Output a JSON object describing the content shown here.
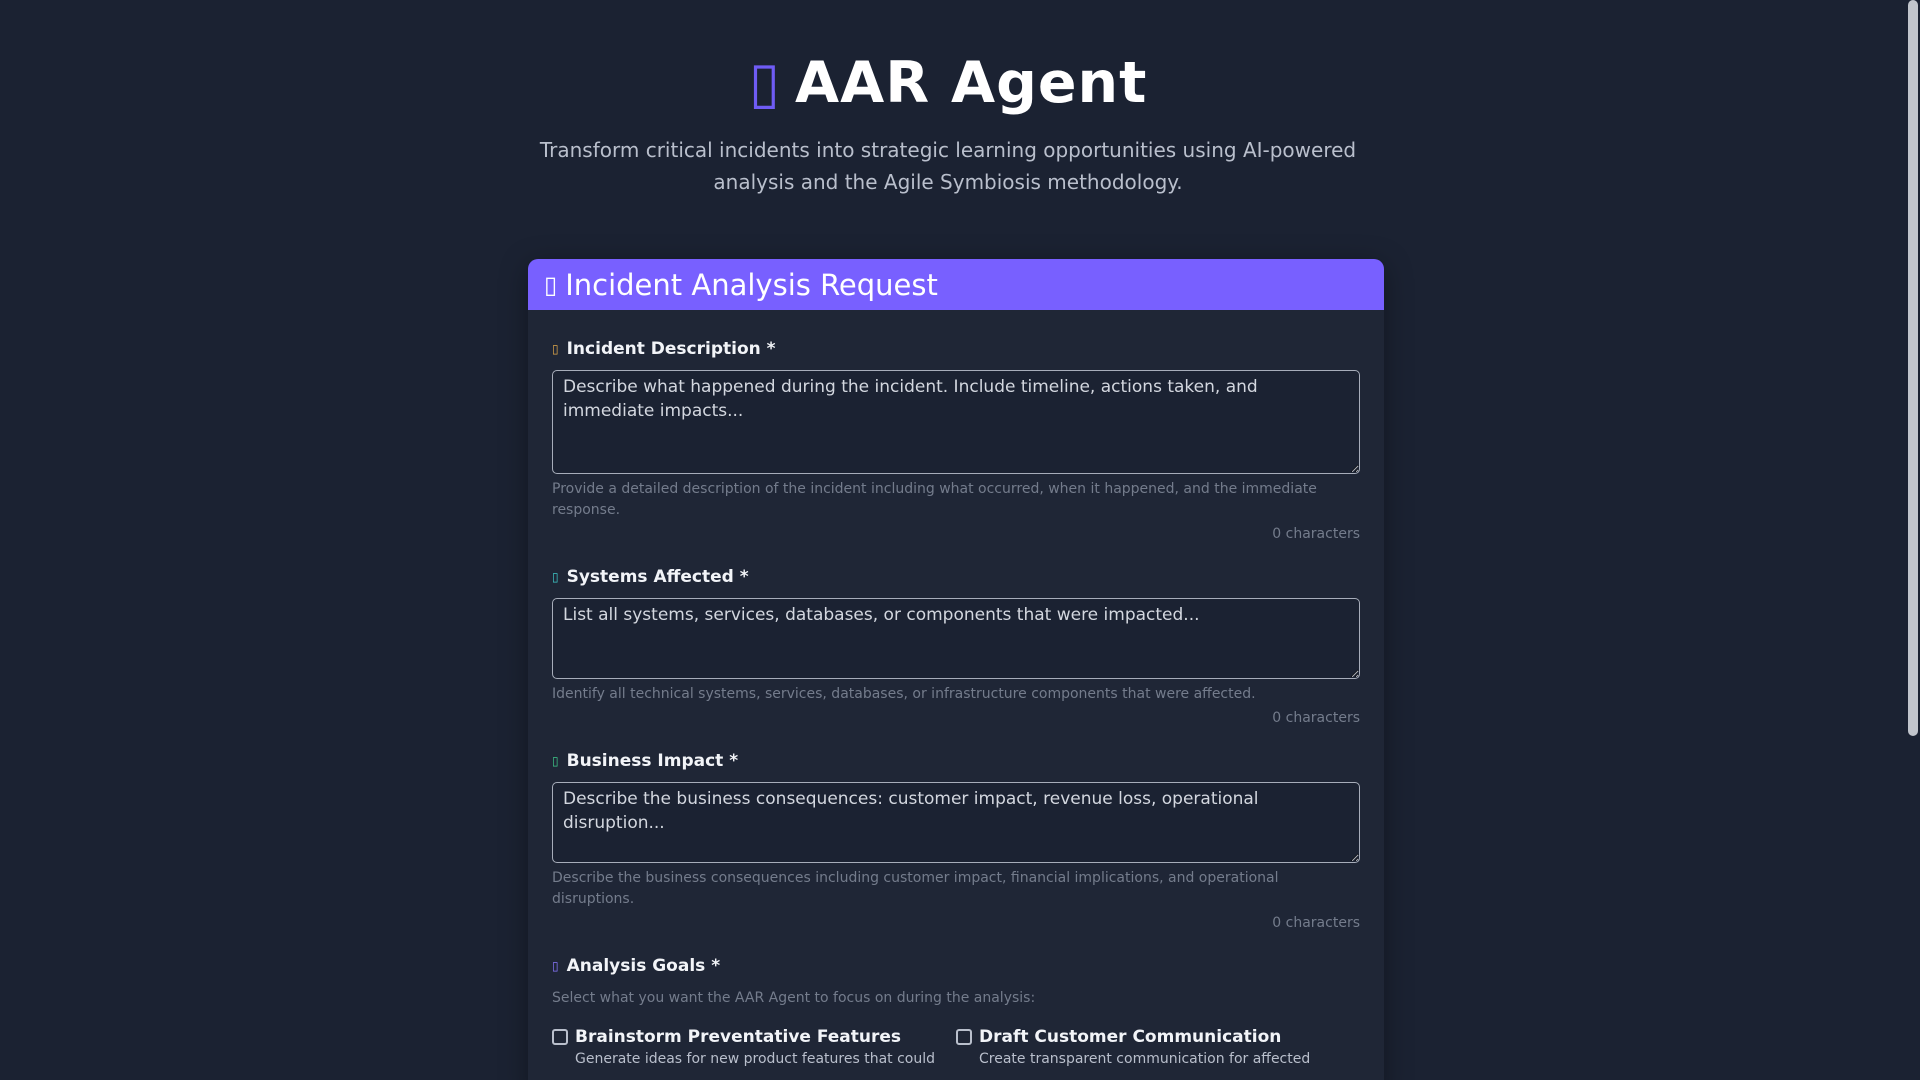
{
  "hero": {
    "icon": "robot-icon",
    "icon_glyph": "▯",
    "title": "AAR Agent",
    "subtitle": "Transform critical incidents into strategic learning opportunities using AI-powered analysis and the Agile Symbiosis methodology."
  },
  "form": {
    "header_icon": "clipboard-icon",
    "header_glyph": "▯",
    "title": "Incident Analysis Request",
    "accent_color": "#7860ff",
    "fields": [
      {
        "icon": "warning-icon",
        "glyph": "▯",
        "glyph_color": "#e0a84a",
        "label": "Incident Description *",
        "placeholder": "Describe what happened during the incident. Include timeline, actions taken, and immediate impacts...",
        "value": "",
        "help": "Provide a detailed description of the incident including what occurred, when it happened, and the immediate response.",
        "count": "0 characters"
      },
      {
        "icon": "server-icon",
        "glyph": "▯",
        "glyph_color": "#3ec9c9",
        "label": "Systems Affected *",
        "placeholder": "List all systems, services, databases, or components that were impacted...",
        "value": "",
        "help": "Identify all technical systems, services, databases, or infrastructure components that were affected.",
        "count": "0 characters"
      },
      {
        "icon": "chart-icon",
        "glyph": "▯",
        "glyph_color": "#3ec98a",
        "label": "Business Impact *",
        "placeholder": "Describe the business consequences: customer impact, revenue loss, operational disruption...",
        "value": "",
        "help": "Describe the business consequences including customer impact, financial implications, and operational disruptions.",
        "count": "0 characters"
      }
    ],
    "goals": {
      "icon": "target-icon",
      "glyph": "▯",
      "glyph_color": "#8a78ff",
      "label": "Analysis Goals *",
      "intro": "Select what you want the AAR Agent to focus on during the analysis:",
      "options": [
        {
          "title": "Brainstorm Preventative Features",
          "desc": "Generate ideas for new product features that could",
          "checked": false
        },
        {
          "title": "Draft Customer Communication",
          "desc": "Create transparent communication for affected",
          "checked": false
        }
      ]
    }
  }
}
